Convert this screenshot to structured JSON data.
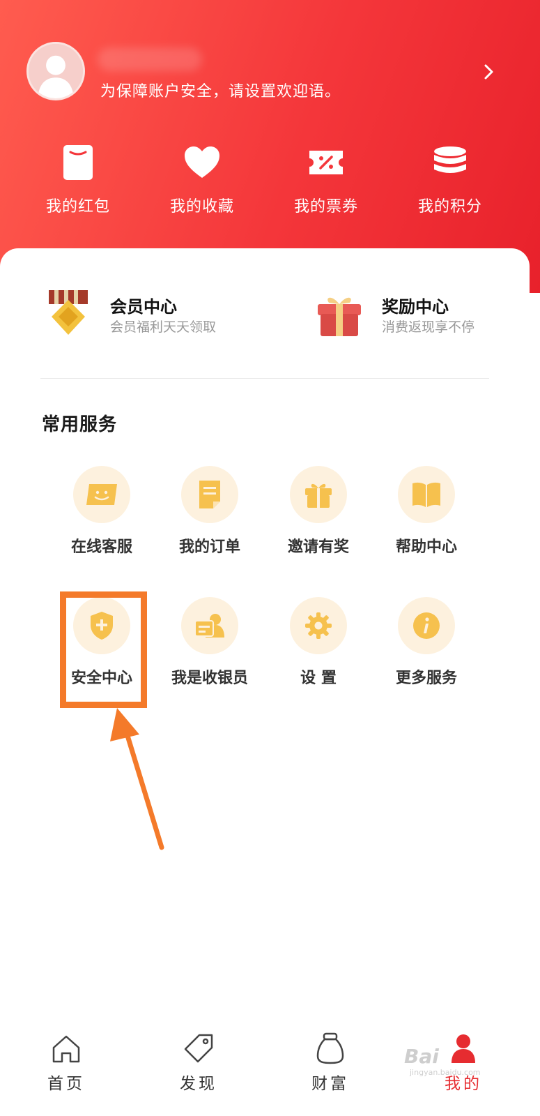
{
  "header": {
    "welcome_text": "为保障账户安全，请设置欢迎语。",
    "shortcuts": [
      {
        "label": "我的红包",
        "icon": "red-envelope-icon"
      },
      {
        "label": "我的收藏",
        "icon": "heart-icon"
      },
      {
        "label": "我的票券",
        "icon": "coupon-icon"
      },
      {
        "label": "我的积分",
        "icon": "coins-icon"
      }
    ]
  },
  "promos": [
    {
      "title": "会员中心",
      "subtitle": "会员福利天天领取",
      "icon": "medal-icon"
    },
    {
      "title": "奖励中心",
      "subtitle": "消费返现享不停",
      "icon": "gift-box-icon"
    }
  ],
  "services": {
    "title": "常用服务",
    "items": [
      {
        "label": "在线客服",
        "icon": "customer-service-icon"
      },
      {
        "label": "我的订单",
        "icon": "order-document-icon"
      },
      {
        "label": "邀请有奖",
        "icon": "gift-icon"
      },
      {
        "label": "帮助中心",
        "icon": "book-icon"
      },
      {
        "label": "安全中心",
        "icon": "shield-icon"
      },
      {
        "label": "我是收银员",
        "icon": "cashier-icon"
      },
      {
        "label": "设 置",
        "icon": "gear-icon"
      },
      {
        "label": "更多服务",
        "icon": "info-icon"
      }
    ]
  },
  "tabbar": {
    "items": [
      {
        "label": "首页",
        "icon": "home-icon"
      },
      {
        "label": "发现",
        "icon": "tag-icon"
      },
      {
        "label": "财富",
        "icon": "money-bag-icon"
      },
      {
        "label": "我的",
        "icon": "user-icon"
      }
    ],
    "active_index": 3
  },
  "watermark": {
    "text": "Bai",
    "subtext": "jingyan.baidu.com"
  },
  "colors": {
    "header_red": "#f4363a",
    "service_icon": "#f6c14e",
    "service_circle": "#fdf1de",
    "highlight_orange": "#f47a2a",
    "active_tab": "#e62c30"
  }
}
